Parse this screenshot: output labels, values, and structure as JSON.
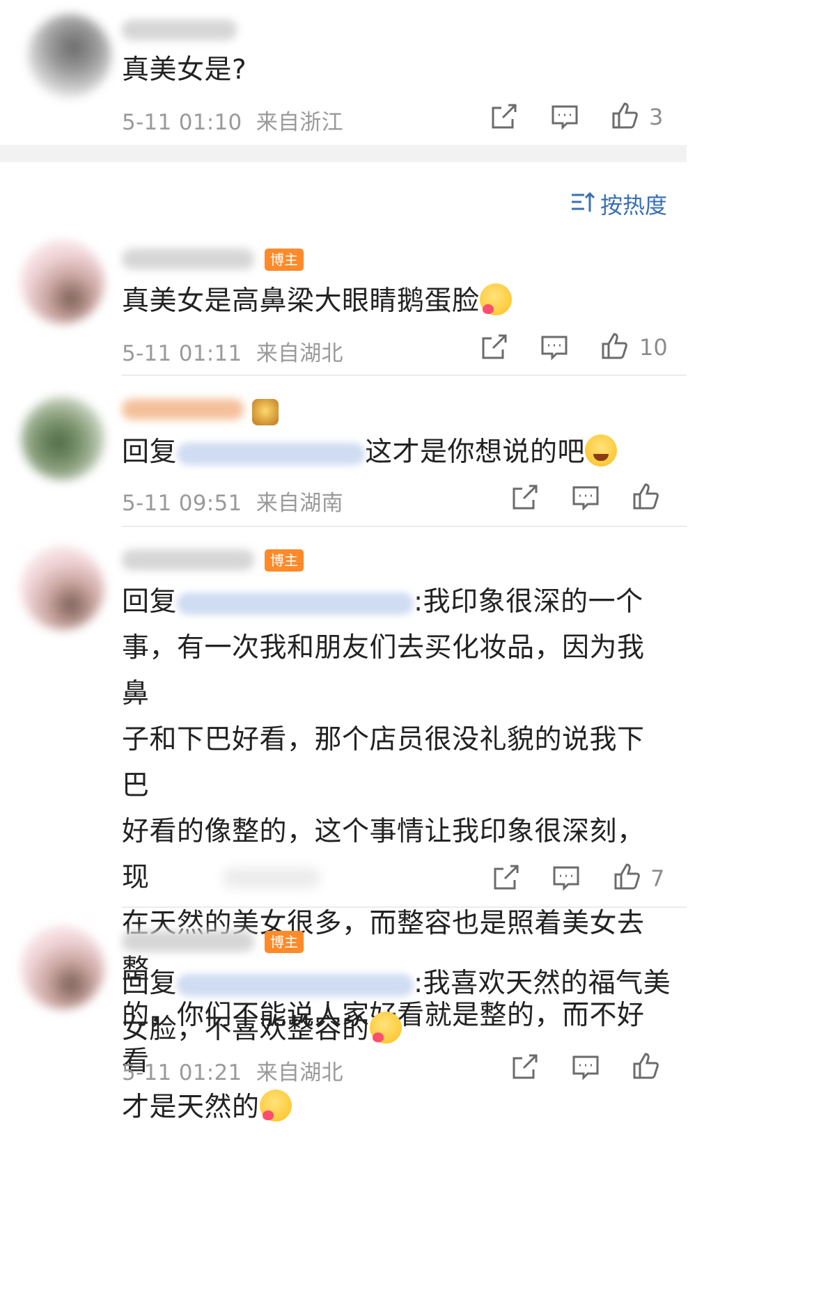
{
  "top_comment": {
    "text": "真美女是?",
    "time": "5-11 01:10",
    "location": "来自浙江",
    "likes": "3"
  },
  "sort": {
    "label": "按热度",
    "icon": "sort-icon"
  },
  "comments": [
    {
      "badge": "博主",
      "text": "真美女是高鼻梁大眼睛鹅蛋脸",
      "time": "5-11 01:11",
      "location": "来自湖北",
      "likes": "10",
      "emoji": "heart-smile-emoji"
    },
    {
      "reply_prefix": "回复",
      "text": "这才是你想说的吧",
      "time": "5-11 09:51",
      "location": "来自湖南",
      "likes": "",
      "emoji": "laugh-cry-emoji"
    },
    {
      "badge": "博主",
      "reply_prefix": "回复",
      "lines": [
        ":我印象很深的一个",
        "事，有一次我和朋友们去买化妆品，因为我鼻",
        "子和下巴好看，那个店员很没礼貌的说我下巴",
        "好看的像整的，这个事情让我印象很深刻，现",
        "在天然的美女很多，而整容也是照着美女去整",
        "的，你们不能说人家好看就是整的，而不好看",
        "才是天然的"
      ],
      "likes": "7",
      "emoji": "heart-smile-emoji"
    },
    {
      "badge": "博主",
      "reply_prefix": "回复",
      "lines": [
        ":我喜欢天然的福气美",
        "女脸，不喜欢整容的"
      ],
      "time": "5-11 01:21",
      "location": "来自湖北",
      "likes": "",
      "emoji": "heart-smile-emoji"
    }
  ],
  "colors": {
    "badge": "#ff8a2a",
    "sort_text": "#3a6fb5",
    "meta": "#9a9a9a",
    "section_gap": "#f2f2f2"
  }
}
